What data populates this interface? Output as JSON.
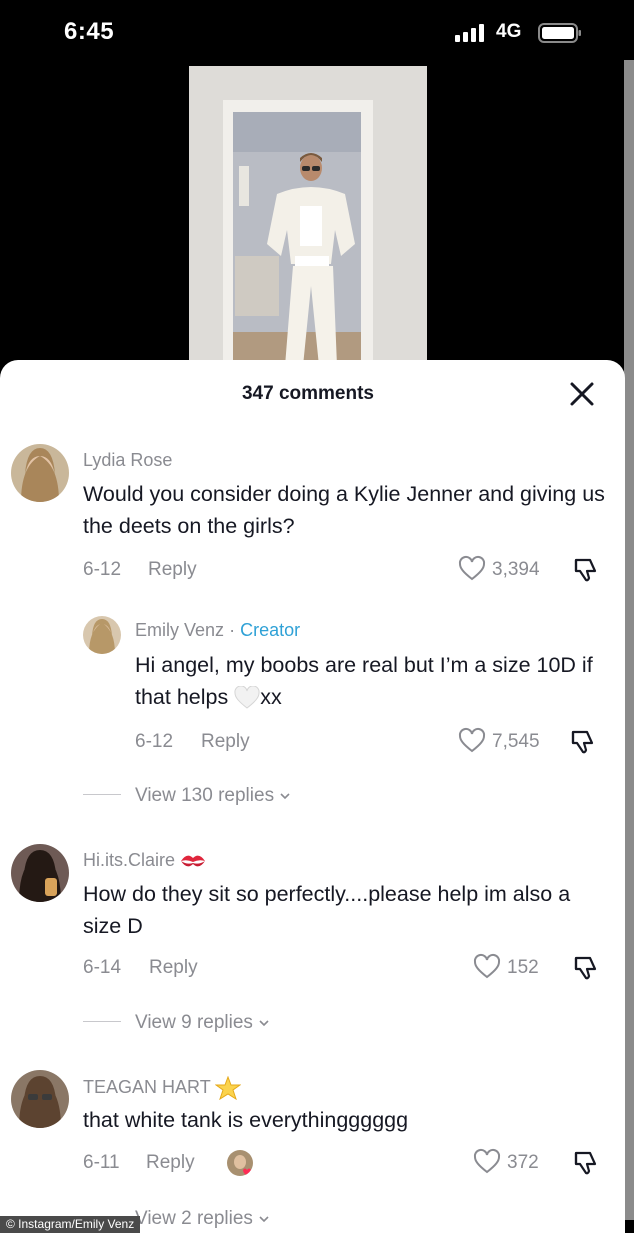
{
  "status_bar": {
    "time": "6:45",
    "network": "4G"
  },
  "sheet": {
    "title": "347 comments"
  },
  "comments": [
    {
      "username": "Lydia Rose",
      "text": "Would you consider doing a Kylie Jenner and giving us the deets on the girls?",
      "date": "6-12",
      "reply_label": "Reply",
      "likes": "3,394"
    },
    {
      "username": "Emily Venz",
      "separator": "·",
      "badge": "Creator",
      "text": "Hi angel, my boobs are real but I’m a size 10D if that helps",
      "text_suffix": "xx",
      "date": "6-12",
      "reply_label": "Reply",
      "likes": "7,545",
      "view_replies": "View 130 replies"
    },
    {
      "username": "Hi.its.Claire",
      "text": "How do they sit so perfectly....please help im also a size D",
      "date": "6-14",
      "reply_label": "Reply",
      "likes": "152",
      "view_replies": "View 9 replies"
    },
    {
      "username": "TEAGAN HART",
      "text": "that white tank is everythingggggg",
      "date": "6-11",
      "reply_label": "Reply",
      "likes": "372",
      "view_replies": "View 2 replies"
    }
  ],
  "credit": "© Instagram/Emily Venz",
  "colors": {
    "creator_badge": "#2fa1d6",
    "secondary_text": "#8a8b91",
    "primary_text": "#161823"
  },
  "icons": [
    "signal-icon",
    "battery-icon",
    "close-icon",
    "heart-icon",
    "dislike-icon",
    "chevron-down-icon",
    "kiss-emoji",
    "star-emoji",
    "white-heart-emoji"
  ]
}
